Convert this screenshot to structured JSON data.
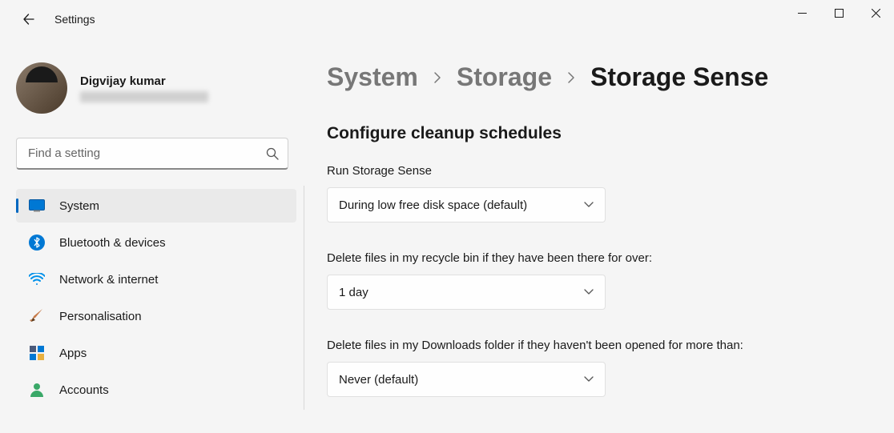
{
  "titlebar": {
    "title": "Settings"
  },
  "user": {
    "name": "Digvijay kumar"
  },
  "search": {
    "placeholder": "Find a setting"
  },
  "nav": {
    "items": [
      {
        "label": "System"
      },
      {
        "label": "Bluetooth & devices"
      },
      {
        "label": "Network & internet"
      },
      {
        "label": "Personalisation"
      },
      {
        "label": "Apps"
      },
      {
        "label": "Accounts"
      }
    ]
  },
  "breadcrumb": {
    "parts": [
      "System",
      "Storage",
      "Storage Sense"
    ]
  },
  "content": {
    "heading": "Configure cleanup schedules",
    "run_label": "Run Storage Sense",
    "run_value": "During low free disk space (default)",
    "recycle_label": "Delete files in my recycle bin if they have been there for over:",
    "recycle_value": "1 day",
    "downloads_label": "Delete files in my Downloads folder if they haven't been opened for more than:",
    "downloads_value": "Never (default)"
  }
}
